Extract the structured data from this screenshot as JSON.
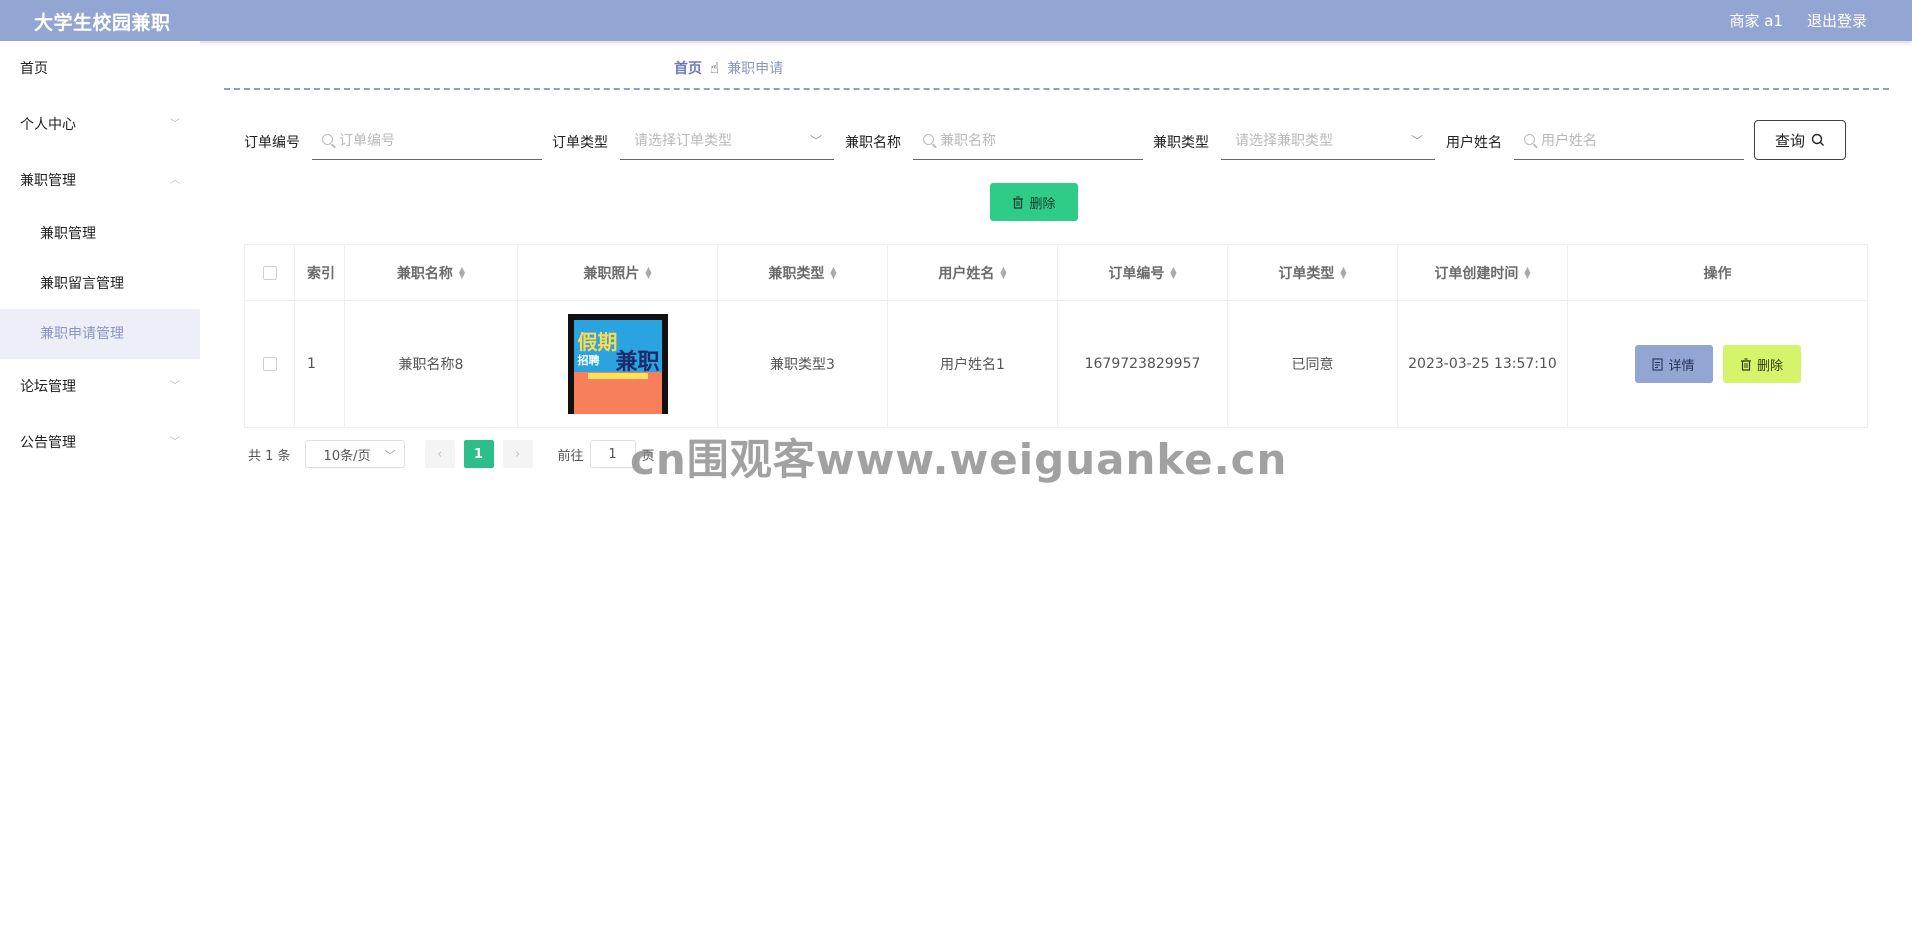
{
  "header": {
    "title": "大学生校园兼职",
    "user": "商家 a1",
    "logout": "退出登录"
  },
  "sidebar": {
    "home": "首页",
    "personal": "个人中心",
    "jobs_group": "兼职管理",
    "jobs_sub": [
      "兼职管理",
      "兼职留言管理",
      "兼职申请管理"
    ],
    "forum": "论坛管理",
    "notice": "公告管理"
  },
  "breadcrumb": {
    "home": "首页",
    "separator": "☝",
    "current": "兼职申请"
  },
  "search": {
    "order_no_label": "订单编号",
    "order_no_placeholder": "订单编号",
    "order_type_label": "订单类型",
    "order_type_placeholder": "请选择订单类型",
    "job_name_label": "兼职名称",
    "job_name_placeholder": "兼职名称",
    "job_type_label": "兼职类型",
    "job_type_placeholder": "请选择兼职类型",
    "user_name_label": "用户姓名",
    "user_name_placeholder": "用户姓名",
    "query_label": "查询"
  },
  "actions": {
    "bulk_delete": "删除"
  },
  "table": {
    "headers": [
      "索引",
      "兼职名称",
      "兼职照片",
      "兼职类型",
      "用户姓名",
      "订单编号",
      "订单类型",
      "订单创建时间",
      "操作"
    ],
    "rows": [
      {
        "index": "1",
        "job_name": "兼职名称8",
        "photo_title": "假期",
        "photo_subtitle": "招聘",
        "photo_big": "兼职",
        "job_type": "兼职类型3",
        "user_name": "用户姓名1",
        "order_no": "1679723829957",
        "order_type": "已同意",
        "created": "2023-03-25 13:57:10",
        "detail": "详情",
        "delete": "删除"
      }
    ]
  },
  "pagination": {
    "total": "共 1 条",
    "page_size": "10条/页",
    "prev": "‹",
    "page": "1",
    "next": "›",
    "goto": "前往",
    "jump_value": "1",
    "page_unit": "页"
  },
  "watermark": "cn围观客www.weiguanke.cn"
}
